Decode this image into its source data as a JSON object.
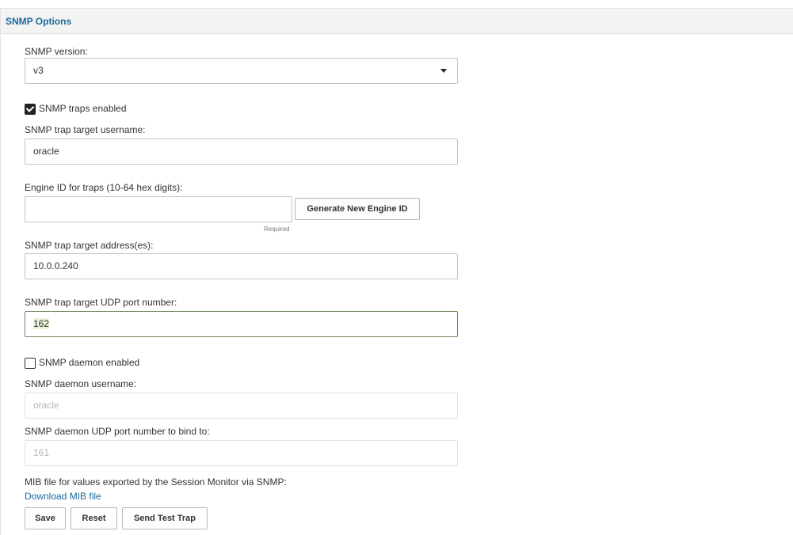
{
  "panel": {
    "title": "SNMP Options"
  },
  "snmp_version": {
    "label": "SNMP version:",
    "value": "v3"
  },
  "traps_enabled": {
    "label": "SNMP traps enabled",
    "checked": true
  },
  "trap_username": {
    "label": "SNMP trap target username:",
    "value": "oracle"
  },
  "engine_id": {
    "label": "Engine ID for traps (10-64 hex digits):",
    "value": "",
    "hint": "Required",
    "generate_label": "Generate New Engine ID"
  },
  "trap_address": {
    "label": "SNMP trap target address(es):",
    "value": "10.0.0.240"
  },
  "trap_port": {
    "label": "SNMP trap target UDP port number:",
    "value": "162"
  },
  "daemon_enabled": {
    "label": "SNMP daemon enabled",
    "checked": false
  },
  "daemon_username": {
    "label": "SNMP daemon username:",
    "placeholder": "oracle"
  },
  "daemon_port": {
    "label": "SNMP daemon UDP port number to bind to:",
    "placeholder": "161"
  },
  "mib": {
    "label": "MIB file for values exported by the Session Monitor via SNMP:",
    "link": "Download MIB file"
  },
  "actions": {
    "save": "Save",
    "reset": "Reset",
    "send_test": "Send Test Trap"
  }
}
